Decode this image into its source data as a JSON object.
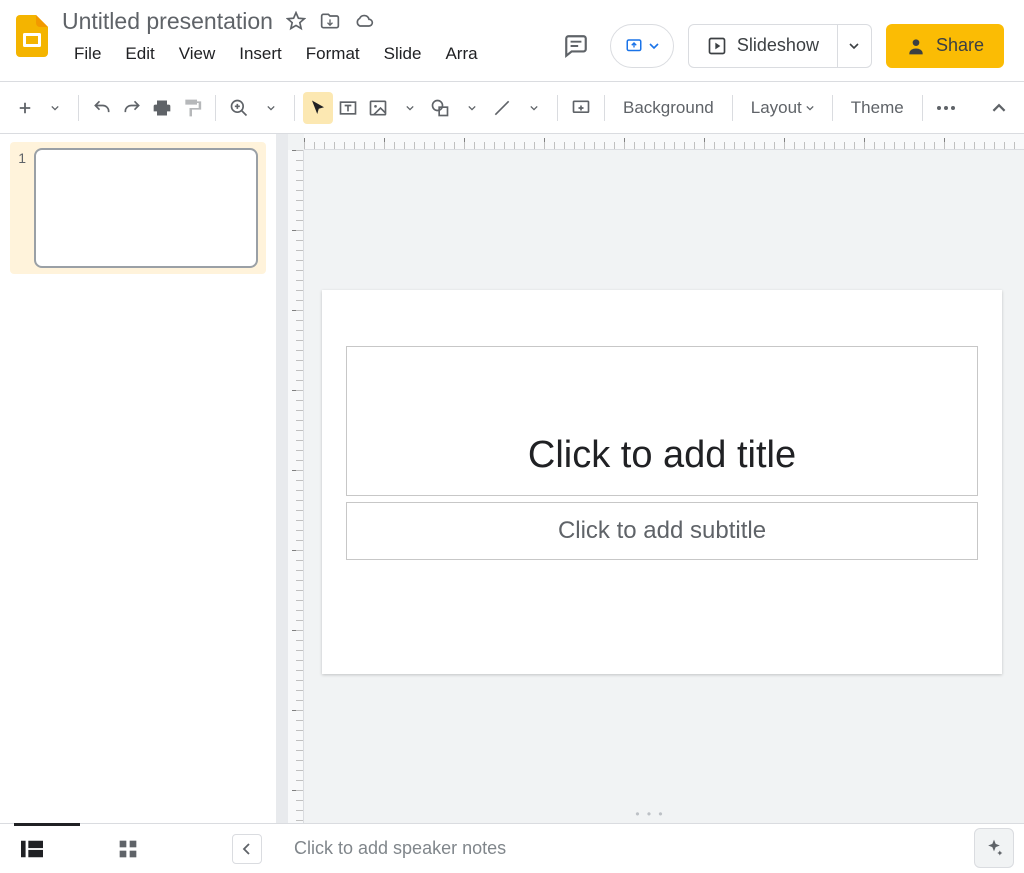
{
  "header": {
    "doc_title": "Untitled presentation",
    "menus": [
      "File",
      "Edit",
      "View",
      "Insert",
      "Format",
      "Slide",
      "Arra"
    ],
    "slideshow_label": "Slideshow",
    "share_label": "Share"
  },
  "toolbar": {
    "background_label": "Background",
    "layout_label": "Layout",
    "theme_label": "Theme"
  },
  "thumbnails": {
    "slides": [
      {
        "num": "1"
      }
    ]
  },
  "canvas": {
    "title_placeholder": "Click to add title",
    "subtitle_placeholder": "Click to add subtitle"
  },
  "bottom": {
    "notes_placeholder": "Click to add speaker notes"
  }
}
